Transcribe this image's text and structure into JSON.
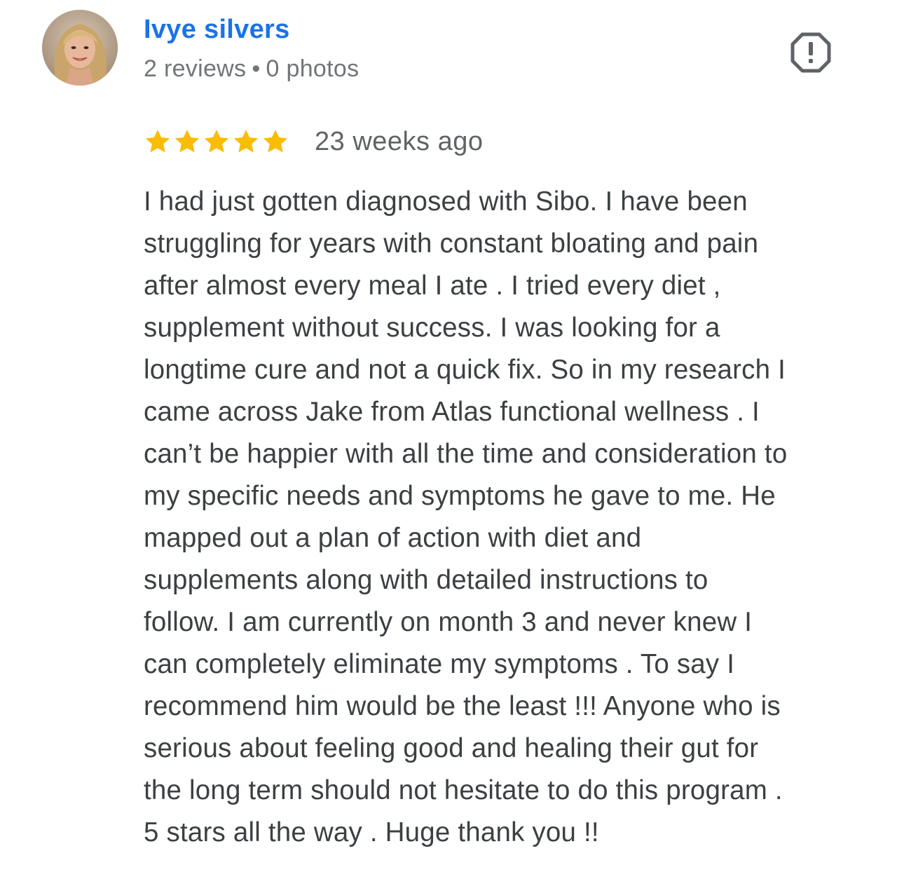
{
  "reviewer": {
    "name": "Ivye silvers",
    "reviews": "2 reviews",
    "separator": "•",
    "photos": "0 photos"
  },
  "review": {
    "rating": 5,
    "max_rating": 5,
    "time_ago": "23 weeks ago",
    "text_lines": [
      "I had just gotten diagnosed with Sibo. I have been",
      "struggling for years with constant bloating and pain",
      "after almost every meal I ate . I tried every diet ,",
      "supplement without success. I was looking for a",
      "longtime cure and not a quick fix. So in my research I",
      "came across Jake from Atlas functional wellness . I",
      "can’t be happier with all the time and consideration to",
      "my specific needs and symptoms he gave to me. He",
      "mapped out a plan of action with diet and",
      "supplements along with detailed instructions to",
      "follow. I am currently on month 3 and never knew I",
      "can completely eliminate my symptoms . To say I",
      "recommend him would be the least !!! Anyone who is",
      "serious about feeling good and healing their gut for",
      "the long term should not hesitate to do this program .",
      "5 stars all the way . Huge thank you !!"
    ]
  },
  "icons": {
    "avatar": "profile-photo",
    "report": "report-flag-icon",
    "star": "star-icon"
  },
  "colors": {
    "name": "#1a73e8",
    "meta": "#70757a",
    "star": "#fbbc04",
    "text": "#3c4043",
    "icon": "#5f6368"
  }
}
